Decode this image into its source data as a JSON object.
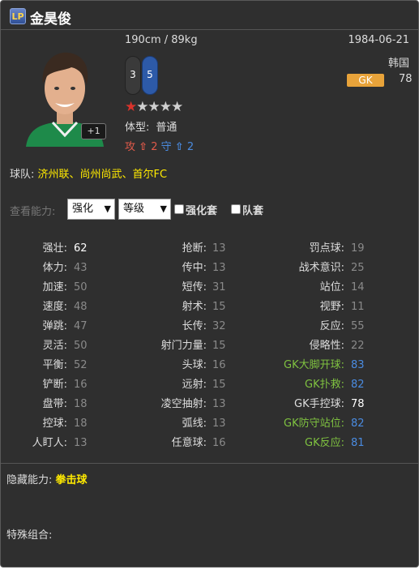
{
  "player": {
    "logo_text": "LP",
    "name": "金昊俊",
    "height_weight": "190cm / 89kg",
    "birthdate": "1984-06-21",
    "nation": "韩国",
    "position": "GK",
    "position_rating": "78",
    "upgrade_badge": "+1",
    "weak_foot_left": "3",
    "weak_foot_right": "5",
    "stars_filled": 1,
    "stars_total": 5,
    "body_type_label": "体型:",
    "body_type_value": "普通",
    "attack_label": "攻",
    "attack_value": "2",
    "defense_label": "守",
    "defense_value": "2"
  },
  "team": {
    "label": "球队:",
    "value": "济州联、尚州尚武、首尔FC"
  },
  "view": {
    "label": "查看能力:",
    "select1": "强化",
    "select2": "等级",
    "checkbox1_label": "强化套",
    "checkbox2_label": "队套"
  },
  "stats": {
    "col1": [
      {
        "label": "强壮:",
        "value": "62",
        "highlight": true
      },
      {
        "label": "体力:",
        "value": "43"
      },
      {
        "label": "加速:",
        "value": "50"
      },
      {
        "label": "速度:",
        "value": "48"
      },
      {
        "label": "弹跳:",
        "value": "47"
      },
      {
        "label": "灵活:",
        "value": "50"
      },
      {
        "label": "平衡:",
        "value": "52"
      },
      {
        "label": "铲断:",
        "value": "16"
      },
      {
        "label": "盘带:",
        "value": "18"
      },
      {
        "label": "控球:",
        "value": "18"
      },
      {
        "label": "人盯人:",
        "value": "13"
      }
    ],
    "col2": [
      {
        "label": "抢断:",
        "value": "13"
      },
      {
        "label": "传中:",
        "value": "13"
      },
      {
        "label": "短传:",
        "value": "31"
      },
      {
        "label": "射术:",
        "value": "15"
      },
      {
        "label": "长传:",
        "value": "32"
      },
      {
        "label": "射门力量:",
        "value": "15"
      },
      {
        "label": "头球:",
        "value": "16"
      },
      {
        "label": "远射:",
        "value": "15"
      },
      {
        "label": "凌空抽射:",
        "value": "13"
      },
      {
        "label": "弧线:",
        "value": "13"
      },
      {
        "label": "任意球:",
        "value": "16"
      }
    ],
    "col3": [
      {
        "label": "罚点球:",
        "value": "19"
      },
      {
        "label": "战术意识:",
        "value": "25"
      },
      {
        "label": "站位:",
        "value": "14"
      },
      {
        "label": "视野:",
        "value": "11"
      },
      {
        "label": "反应:",
        "value": "55"
      },
      {
        "label": "侵略性:",
        "value": "22"
      },
      {
        "label": "GK大脚开球:",
        "value": "83",
        "gk": true
      },
      {
        "label": "GK扑救:",
        "value": "82",
        "gk": true
      },
      {
        "label": "GK手控球:",
        "value": "78",
        "highlight": true
      },
      {
        "label": "GK防守站位:",
        "value": "82",
        "gk": true
      },
      {
        "label": "GK反应:",
        "value": "81",
        "gk": true
      }
    ]
  },
  "hidden": {
    "label": "隐藏能力:",
    "value": "拳击球"
  },
  "combo": {
    "label": "特殊组合:"
  },
  "colors": {
    "gk_label": "#7fc240",
    "gk_value": "#4a8be0",
    "normal_label": "#dddddd",
    "normal_value": "#8a8a8a",
    "highlight_value": "#ffffff",
    "position_badge": "#e8a33a",
    "team_text": "#ffea00"
  }
}
